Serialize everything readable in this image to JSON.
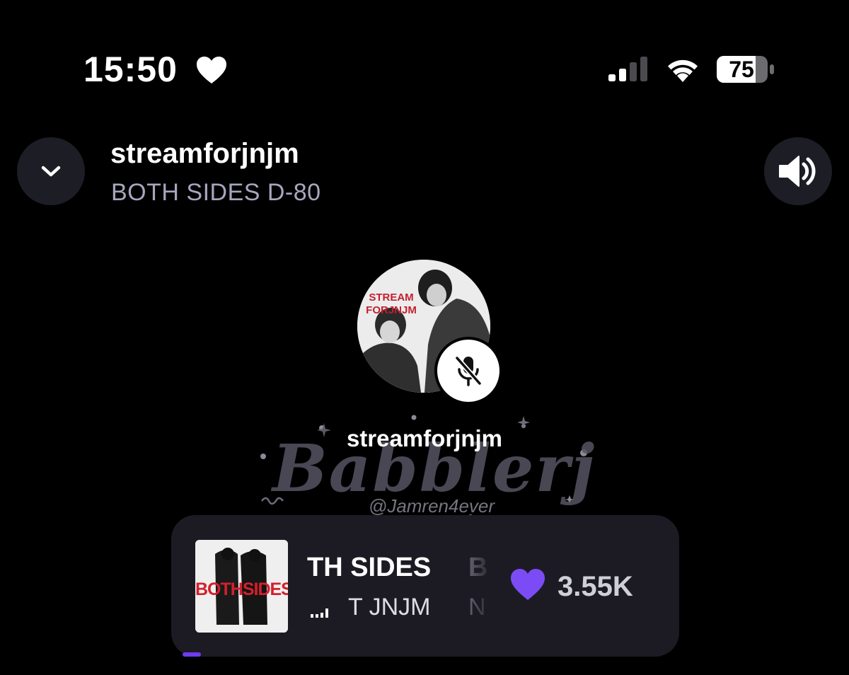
{
  "status_bar": {
    "time": "15:50",
    "battery_percent": "75",
    "signal_bars_active": 2,
    "signal_bars_total": 4,
    "icons": [
      "heart-icon",
      "signal-icon",
      "wifi-icon",
      "battery-icon"
    ]
  },
  "header": {
    "host_name": "streamforjnjm",
    "subtitle": "BOTH SIDES D-80",
    "collapse_icon": "chevron-down-icon",
    "volume_icon": "speaker-volume-icon"
  },
  "speaker": {
    "name": "streamforjnjm",
    "avatar_text_line1": "STREAM",
    "avatar_text_line2": "FORJNJM",
    "muted": true
  },
  "watermark": {
    "title": "Babblerj",
    "handle": "@Jamren4ever"
  },
  "now_playing": {
    "album_art_text": "BOTHSIDES",
    "title_visible": "TH SIDES",
    "title_next_visible": "B",
    "artist_visible": "T JNJM",
    "artist_next_visible": "N",
    "like_count": "3.55K",
    "like_icon": "heart-icon"
  },
  "colors": {
    "background": "#000000",
    "button_bg": "#1d1d26",
    "card_bg": "#1c1b24",
    "accent_purple": "#7b4cf5",
    "subtitle_gray": "#a7a6be"
  }
}
